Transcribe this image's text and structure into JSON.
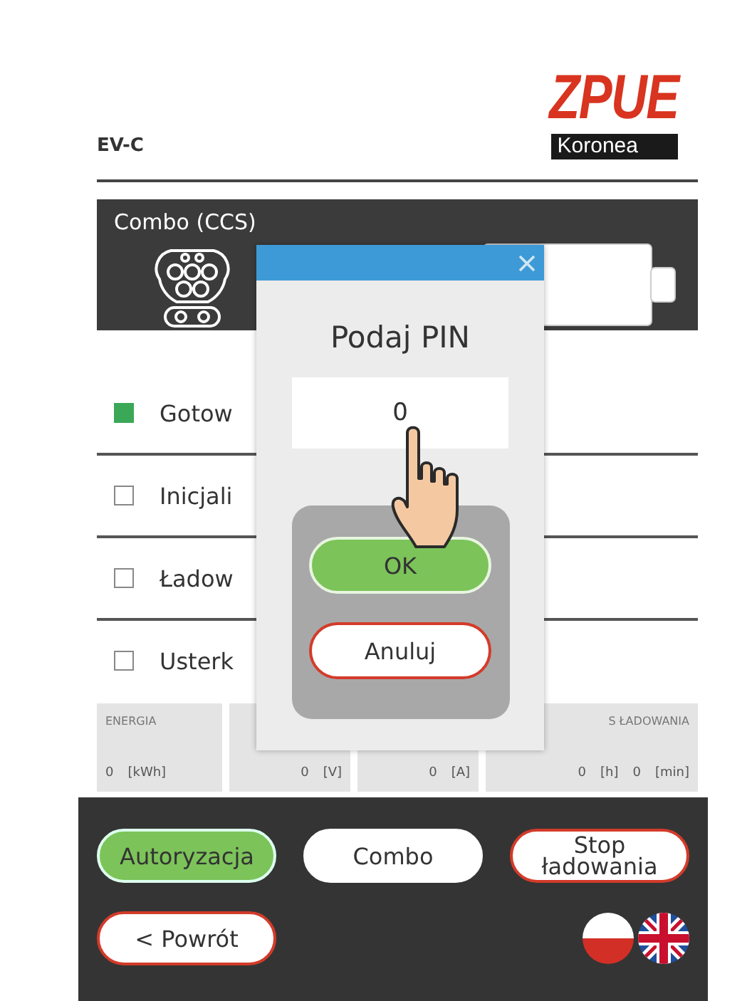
{
  "header": {
    "title": "EV-C",
    "logo": {
      "brand": "ZPUE",
      "sub": "Koronea"
    }
  },
  "connector": {
    "name": "Combo (CCS)"
  },
  "statuses": [
    {
      "label": "Gotow",
      "on": true
    },
    {
      "label": "Inicjali",
      "on": false
    },
    {
      "label": "Ładow",
      "on": false
    },
    {
      "label": "Usterk",
      "on": false
    }
  ],
  "stats": [
    {
      "header": "ENERGIA",
      "values": [
        {
          "value": "0",
          "unit": "[kWh]"
        }
      ]
    },
    {
      "values": [
        {
          "value": "0",
          "unit": "[V]"
        }
      ]
    },
    {
      "values": [
        {
          "value": "0",
          "unit": "[A]"
        }
      ]
    },
    {
      "header": "S ŁADOWANIA",
      "values": [
        {
          "value": "0",
          "unit": "[h]"
        },
        {
          "value": "0",
          "unit": "[min]"
        }
      ]
    }
  ],
  "buttons": [
    {
      "label": "Autoryzacja",
      "kind": "active"
    },
    {
      "label": "Combo",
      "kind": "plain"
    },
    {
      "label": "Stop ładowania",
      "kind": "danger"
    }
  ],
  "back_button": {
    "label": "< Powrót"
  },
  "languages": [
    {
      "kind": "pl"
    },
    {
      "kind": "gb"
    }
  ],
  "dialog": {
    "title": "Podaj PIN",
    "pin": {
      "value": "0"
    },
    "buttons": [
      {
        "label": "OK",
        "kind": "confirm"
      },
      {
        "label": "Anuluj",
        "kind": "cancel"
      }
    ]
  }
}
